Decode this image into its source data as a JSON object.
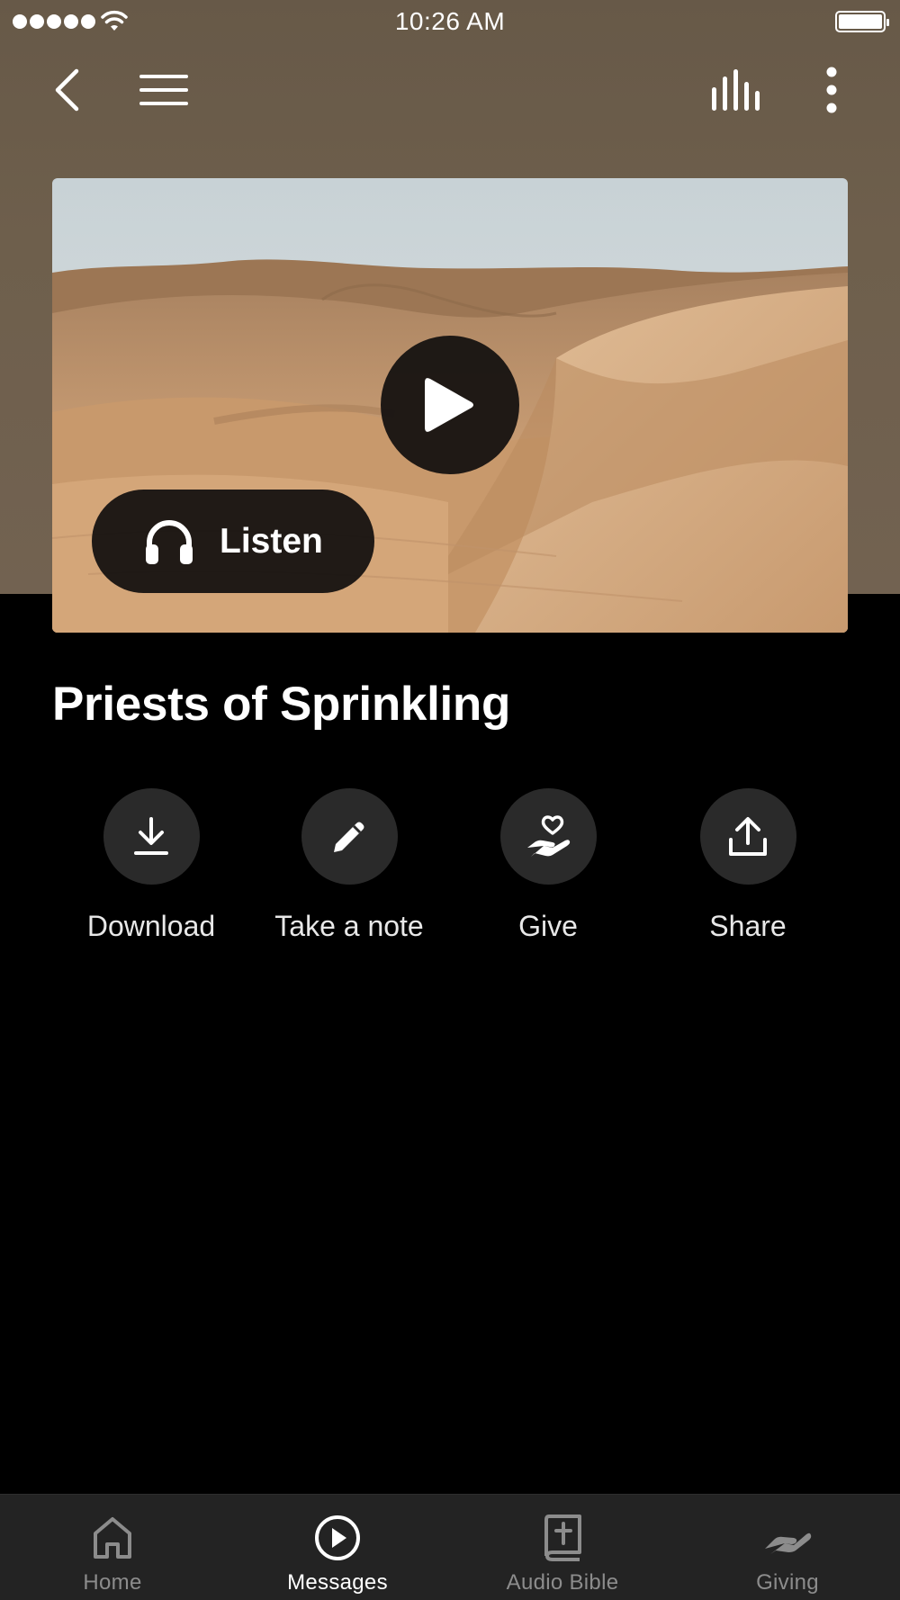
{
  "status_bar": {
    "time": "10:26 AM",
    "signal_bars": 5,
    "battery_level": 1.0
  },
  "top_nav": {
    "icons": [
      "chevron-left-icon",
      "hamburger-menu-icon",
      "audio-bars-icon",
      "more-vertical-icon"
    ]
  },
  "hero": {
    "play_icon": "play-icon",
    "listen_label": "Listen",
    "listen_icon": "headphones-icon"
  },
  "title": "Priests of Sprinkling",
  "actions": [
    {
      "label": "Download",
      "icon": "download-icon"
    },
    {
      "label": "Take a note",
      "icon": "pencil-icon"
    },
    {
      "label": "Give",
      "icon": "heart-hand-icon"
    },
    {
      "label": "Share",
      "icon": "share-upload-icon"
    }
  ],
  "tab_bar": {
    "active": "Messages",
    "tabs": [
      {
        "label": "Home",
        "icon": "home-icon"
      },
      {
        "label": "Messages",
        "icon": "play-circle-icon"
      },
      {
        "label": "Audio Bible",
        "icon": "bible-icon"
      },
      {
        "label": "Giving",
        "icon": "giving-hand-icon"
      }
    ]
  },
  "colors": {
    "header_brown": "#6e5f4c",
    "background": "#000000",
    "tab_bar": "#232323",
    "action_circle": "#2a2a2a",
    "inactive_tab": "#8c8c8c"
  }
}
